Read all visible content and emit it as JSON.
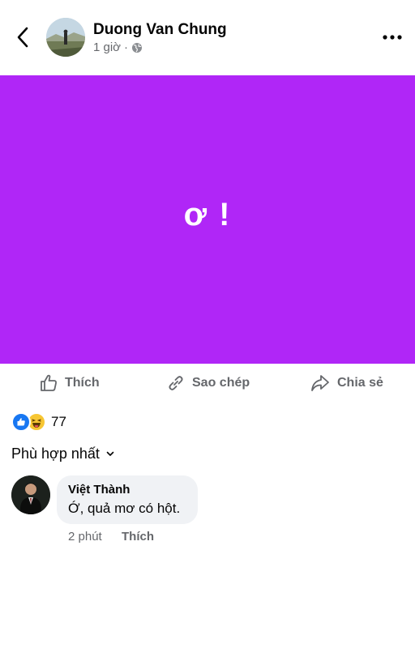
{
  "header": {
    "author_name": "Duong Van Chung",
    "timestamp": "1 giờ",
    "separator": "·",
    "privacy_icon": "globe-icon",
    "back_icon": "chevron-left-icon",
    "more_icon": "more-horizontal-icon"
  },
  "post": {
    "text": "ơ !",
    "background_color": "#b026f7"
  },
  "actions": {
    "like_label": "Thích",
    "copy_label": "Sao chép",
    "share_label": "Chia sẻ"
  },
  "reactions": {
    "icons": [
      "like-reaction-icon",
      "haha-reaction-icon"
    ],
    "count": "77"
  },
  "sort": {
    "label": "Phù hợp nhất"
  },
  "comments": [
    {
      "author": "Việt Thành",
      "text": "Ớ, quả mơ có hột.",
      "time": "2 phút",
      "like_label": "Thích"
    }
  ],
  "colors": {
    "accent": "#1877f2",
    "secondary_text": "#65676b",
    "bubble": "#f0f2f5"
  }
}
